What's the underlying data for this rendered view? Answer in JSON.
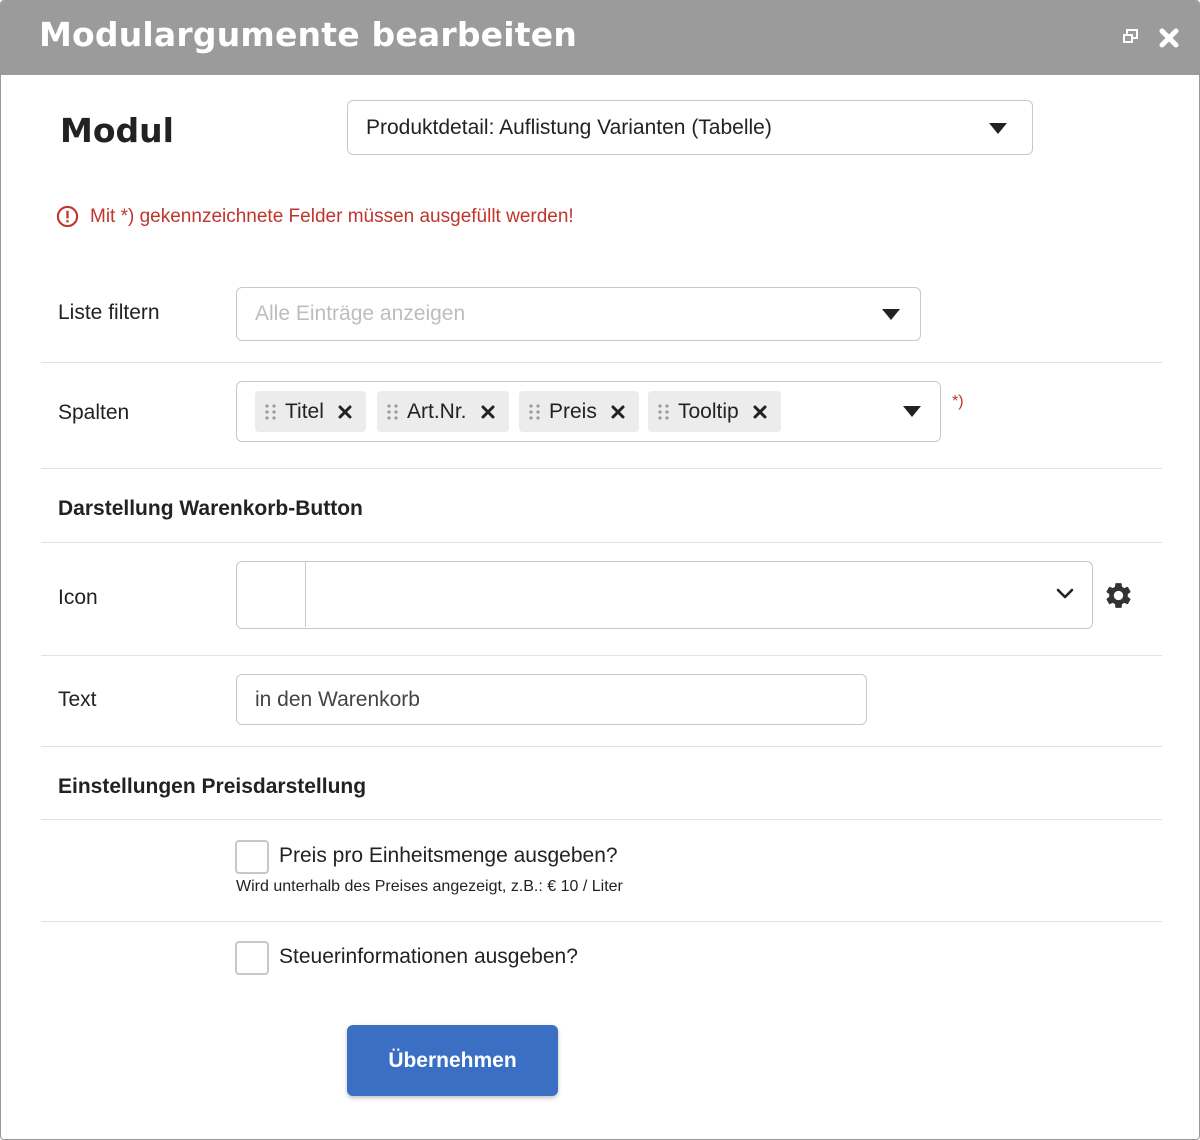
{
  "window": {
    "title": "Modulargumente bearbeiten",
    "restore_icon": "restore-window-icon",
    "close_icon": "close-icon"
  },
  "modul": {
    "label": "Modul",
    "selected": "Produktdetail: Auflistung Varianten (Tabelle)"
  },
  "error_message": "Mit *) gekennzeichnete Felder müssen ausgefüllt werden!",
  "colors": {
    "titlebar": "#9b9b9b",
    "error": "#c0352b",
    "primary_button": "#3b6fc4",
    "chip_bg": "#ececec"
  },
  "fields": {
    "filter": {
      "label": "Liste filtern",
      "placeholder": "Alle Einträge anzeigen"
    },
    "spalten": {
      "label": "Spalten",
      "chips": [
        "Titel",
        "Art.Nr.",
        "Preis",
        "Tooltip"
      ],
      "required_marker": "*)"
    }
  },
  "section_button": {
    "heading": "Darstellung Warenkorb-Button",
    "icon_label": "Icon",
    "icon_value": "",
    "text_label": "Text",
    "text_value": "in den Warenkorb"
  },
  "section_price": {
    "heading": "Einstellungen Preisdarstellung",
    "unit_price_label": "Preis pro Einheitsmenge ausgeben?",
    "unit_price_checked": false,
    "unit_price_hint": "Wird unterhalb des Preises angezeigt, z.B.: € 10 / Liter",
    "tax_label": "Steuerinformationen ausgeben?",
    "tax_checked": false
  },
  "submit_label": "Übernehmen"
}
